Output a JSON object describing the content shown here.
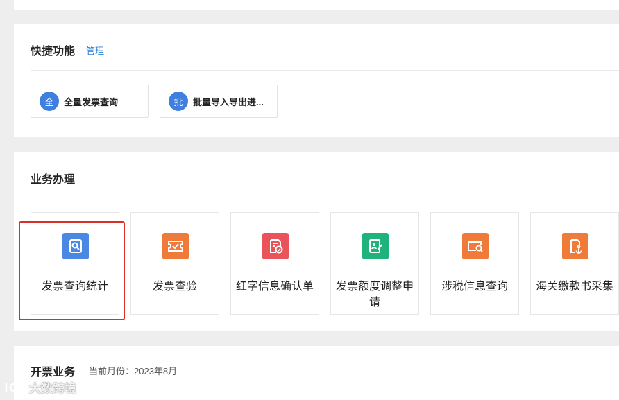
{
  "quick": {
    "title": "快捷功能",
    "manage_label": "管理",
    "items": [
      {
        "badge": "全",
        "label": "全量发票查询"
      },
      {
        "badge": "批",
        "label": "批量导入导出进..."
      }
    ]
  },
  "business": {
    "title": "业务办理",
    "tiles": [
      {
        "label": "发票查询统计",
        "icon": "invoice-search-icon",
        "color": "#4a88e4"
      },
      {
        "label": "发票查验",
        "icon": "ticket-verify-icon",
        "color": "#ef7a3a"
      },
      {
        "label": "红字信息确认单",
        "icon": "doc-check-icon",
        "color": "#e9545a"
      },
      {
        "label": "发票额度调整申请",
        "icon": "edit-doc-icon",
        "color": "#20b27c"
      },
      {
        "label": "涉税信息查询",
        "icon": "card-search-icon",
        "color": "#ef7a3a"
      },
      {
        "label": "海关缴款书采集",
        "icon": "anchor-doc-icon",
        "color": "#ef7a3a"
      }
    ],
    "selected_index": 0
  },
  "invoice": {
    "title": "开票业务",
    "month_label": "当前月份：2023年8月"
  },
  "watermark": {
    "text": "大数跨境"
  }
}
